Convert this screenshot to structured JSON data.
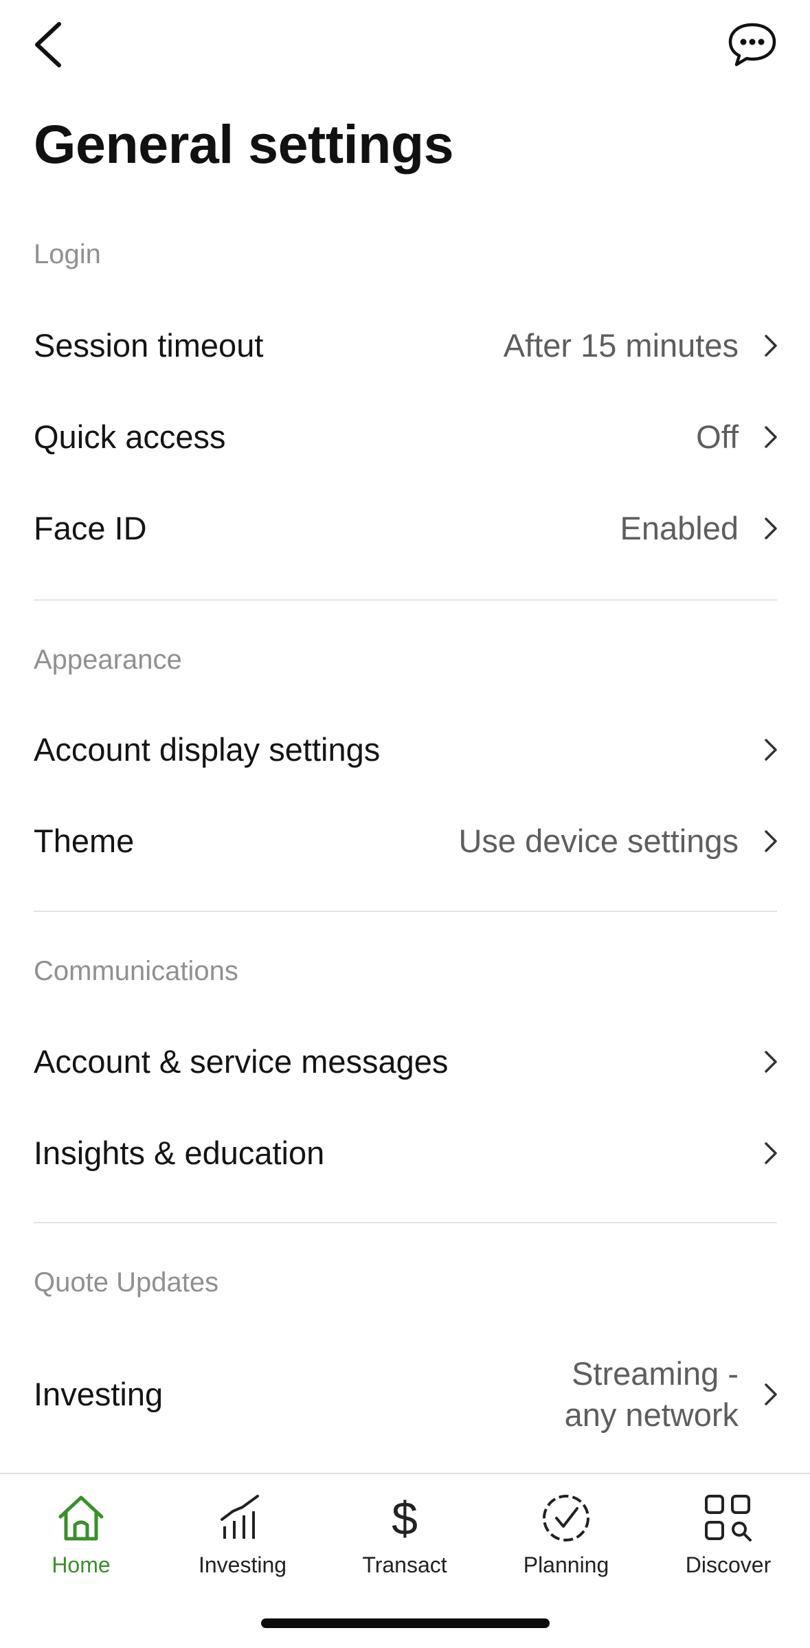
{
  "header": {
    "back_icon": "chevron-left-icon",
    "chat_icon": "chat-bubble-icon",
    "title": "General settings"
  },
  "sections": [
    {
      "heading": "Login",
      "rows": [
        {
          "label": "Session timeout",
          "value": "After 15 minutes"
        },
        {
          "label": "Quick access",
          "value": "Off"
        },
        {
          "label": "Face ID",
          "value": "Enabled"
        }
      ]
    },
    {
      "heading": "Appearance",
      "rows": [
        {
          "label": "Account display settings",
          "value": ""
        },
        {
          "label": "Theme",
          "value": "Use device settings"
        }
      ]
    },
    {
      "heading": "Communications",
      "rows": [
        {
          "label": "Account & service messages",
          "value": ""
        },
        {
          "label": "Insights & education",
          "value": ""
        }
      ]
    },
    {
      "heading": "Quote Updates",
      "rows": [
        {
          "label": "Investing",
          "value_line1": "Streaming -",
          "value_line2": "any network"
        }
      ]
    }
  ],
  "tabbar": {
    "active_color": "#3a8f2c",
    "tabs": [
      {
        "label": "Home",
        "icon": "home-icon",
        "active": true
      },
      {
        "label": "Investing",
        "icon": "bar-chart-icon",
        "active": false
      },
      {
        "label": "Transact",
        "icon": "dollar-icon",
        "active": false
      },
      {
        "label": "Planning",
        "icon": "dashed-check-circle-icon",
        "active": false
      },
      {
        "label": "Discover",
        "icon": "grid-search-icon",
        "active": false
      }
    ]
  }
}
